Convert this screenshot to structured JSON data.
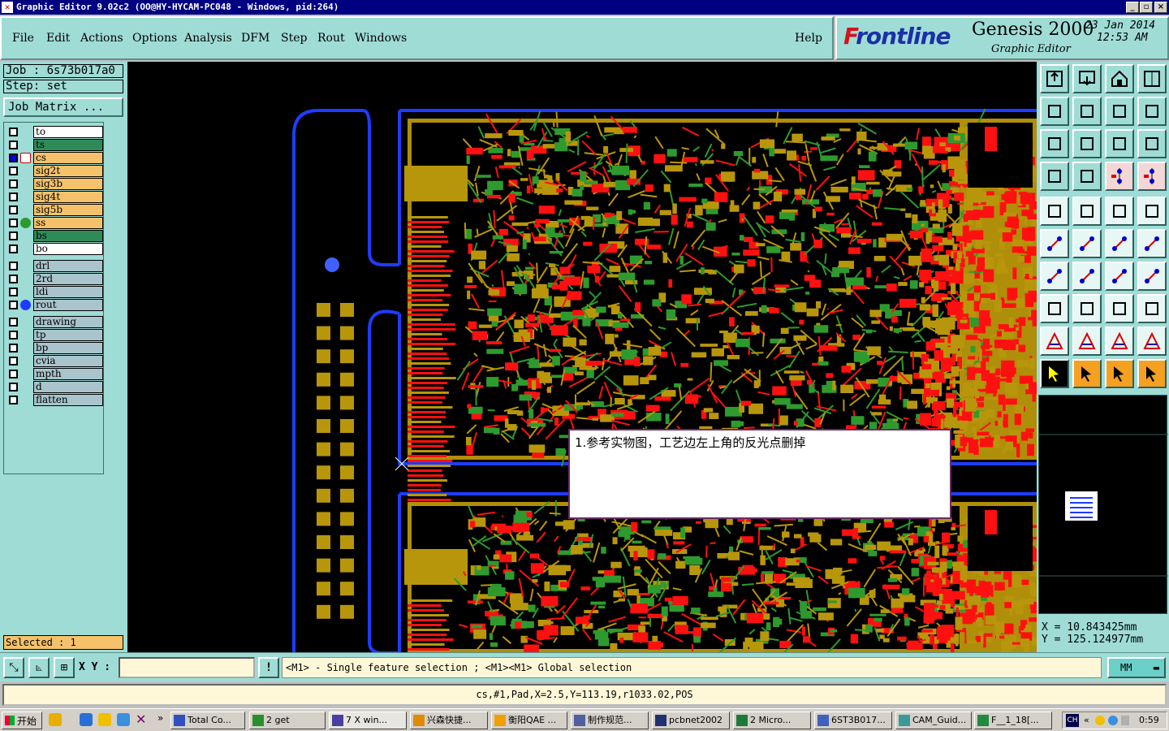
{
  "window": {
    "title": "Graphic Editor 9.02c2 (OO@HY-HYCAM-PC048 - Windows, pid:264)",
    "controls": [
      "_",
      "▫",
      "×"
    ]
  },
  "menu": [
    "File",
    "Edit",
    "Actions",
    "Options",
    "Analysis",
    "DFM",
    "Step",
    "Rout",
    "Windows"
  ],
  "help_label": "Help",
  "brand": {
    "logo_prefix": "F",
    "logo_rest": "rontline",
    "product": "Genesis 2000",
    "subtitle": "Graphic Editor",
    "date": "23 Jan 2014",
    "time": "12:53 AM"
  },
  "job": {
    "job_label": "Job : 6s73b017a0",
    "step_label": "Step: set",
    "matrix_button": "Job Matrix ..."
  },
  "layers": [
    {
      "name": "to",
      "color": "#ffffff",
      "selected": false,
      "marker": null
    },
    {
      "name": "ts",
      "color": "#2e8b57",
      "selected": false,
      "marker": null
    },
    {
      "name": "cs",
      "color": "#f5c26b",
      "selected": true,
      "marker": "work"
    },
    {
      "name": "sig2t",
      "color": "#f5c26b",
      "selected": false,
      "marker": null
    },
    {
      "name": "sig3b",
      "color": "#f5c26b",
      "selected": false,
      "marker": null
    },
    {
      "name": "sig4t",
      "color": "#f5c26b",
      "selected": false,
      "marker": null
    },
    {
      "name": "sig5b",
      "color": "#f5c26b",
      "selected": false,
      "marker": null
    },
    {
      "name": "ss",
      "color": "#f5c26b",
      "selected": false,
      "marker": "green"
    },
    {
      "name": "bs",
      "color": "#2e8b57",
      "selected": false,
      "marker": null
    },
    {
      "name": "bo",
      "color": "#ffffff",
      "selected": false,
      "marker": null
    },
    {
      "name": "drl",
      "color": "#a9c4cc",
      "selected": false,
      "marker": null
    },
    {
      "name": "2rd",
      "color": "#a9c4cc",
      "selected": false,
      "marker": null
    },
    {
      "name": "ldi",
      "color": "#a9c4cc",
      "selected": false,
      "marker": null
    },
    {
      "name": "rout",
      "color": "#a9c4cc",
      "selected": false,
      "marker": "blue"
    },
    {
      "name": "drawing",
      "color": "#a9c4cc",
      "selected": false,
      "marker": null
    },
    {
      "name": "tp",
      "color": "#a9c4cc",
      "selected": false,
      "marker": null
    },
    {
      "name": "bp",
      "color": "#a9c4cc",
      "selected": false,
      "marker": null
    },
    {
      "name": "cvia",
      "color": "#a9c4cc",
      "selected": false,
      "marker": null
    },
    {
      "name": "mpth",
      "color": "#a9c4cc",
      "selected": false,
      "marker": null
    },
    {
      "name": "d",
      "color": "#a9c4cc",
      "selected": false,
      "marker": null
    },
    {
      "name": "flatten",
      "color": "#a9c4cc",
      "selected": false,
      "marker": null
    }
  ],
  "selected_count": "Selected : 1",
  "note": "1.参考实物图，工艺边左上角的反光点删掉",
  "coords": {
    "x": "X  =  10.843425mm",
    "y": "Y  =  125.124977mm"
  },
  "status": {
    "xy_label": "X Y :",
    "hint": "<M1> - Single feature selection ; <M1><M1> Global selection",
    "units": "MM",
    "info": "cs,#1,Pad,X=2.5,Y=113.19,r1033.02,POS"
  },
  "taskbar": {
    "start": "开始",
    "items": [
      "Total Co...",
      "2 get",
      "7 X win...",
      "兴森快捷...",
      "衡阳QAE ...",
      "制作规范...",
      "pcbnet2002",
      "2 Micro...",
      "6ST3B017...",
      "CAM_Guid...",
      "F__1_18[..."
    ],
    "tray_lang": "CH",
    "clock": "0:59"
  },
  "toolbar_icons": [
    "zoom-home-icon",
    "zoom-fit-icon",
    "house-icon",
    "window-icon",
    "pan-left-icon",
    "pan-right-icon",
    "mirror-icon",
    "redraw-icon",
    "zoom-extents-icon",
    "center-icon",
    "ratio-icon",
    "help-query-icon",
    "snap-settings-icon",
    "grid-icon",
    "net-select-icon",
    "net-select-alt-icon",
    "add-pad-icon",
    "add-shape-icon",
    "measure-icon",
    "pad-outline-icon",
    "connect-nodes-icon",
    "delete-node-icon",
    "move-node-icon",
    "add-node-icon",
    "add-line-icon",
    "draw-line-icon",
    "add-arc-icon",
    "flip-text-icon",
    "edit-points-icon",
    "cut-line-icon",
    "resize-icon",
    "copy-object-icon",
    "triangle-red-icon",
    "triangle-line-icon",
    "triangle-a-icon",
    "triangle-a2-icon",
    "pointer-icon",
    "pointer-select-icon",
    "pointer-move-icon",
    "node-edit-icon"
  ],
  "colors": {
    "panel": "#9fdcd6",
    "canvas": "#000000",
    "copper": "#b8960b",
    "route": "#1e3cff",
    "smask": "#2e9a2e",
    "hilite": "#ff1010"
  }
}
